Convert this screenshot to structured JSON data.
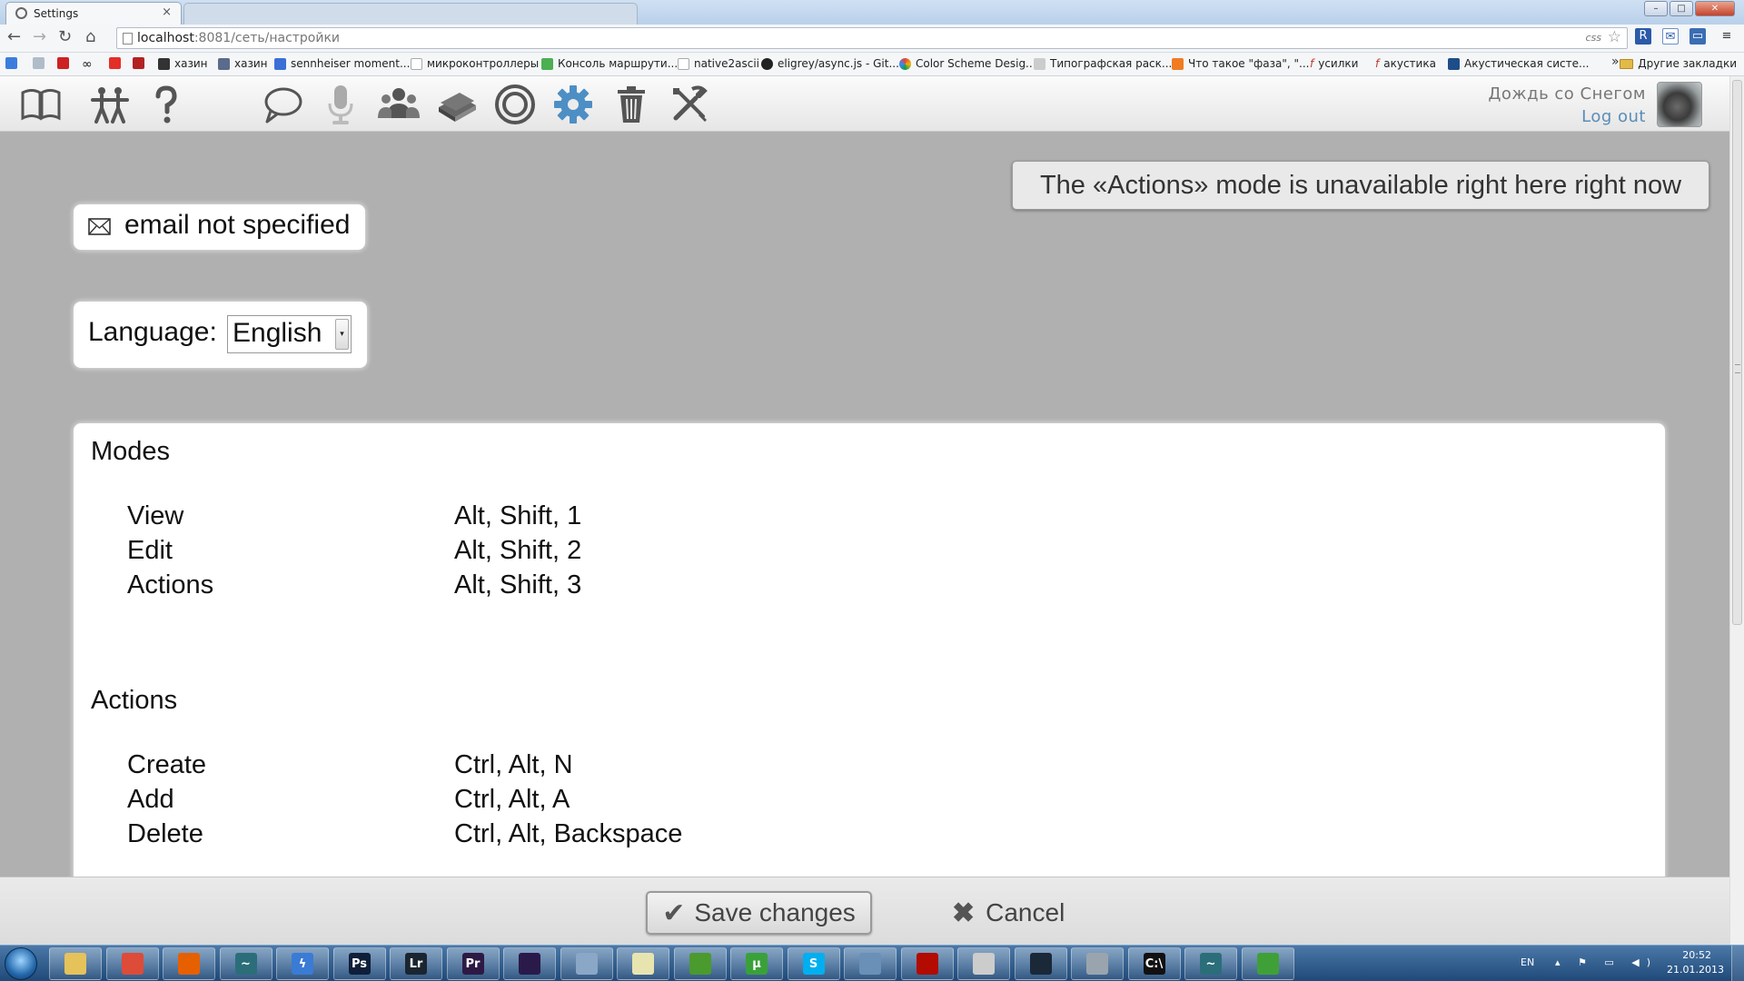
{
  "browser": {
    "active_tab_title": "Settings",
    "tab_close_glyph": "×",
    "url_host": "localhost",
    "url_path": ":8081/сеть/настройки",
    "css_badge": "css",
    "bookmarks": [
      {
        "label": "хазин",
        "color": "#333333"
      },
      {
        "label": "хазин",
        "color": "#5b6b8a"
      },
      {
        "label": "sennheiser moment...",
        "color": "#3b6fd6"
      },
      {
        "label": "микроконтроллеры",
        "color": "#bbbbbb"
      },
      {
        "label": "Консоль маршрути...",
        "color": "#4caf50"
      },
      {
        "label": "native2ascii",
        "color": "#bbbbbb"
      },
      {
        "label": "eligrey/async.js - Git...",
        "color": "#222222"
      },
      {
        "label": "Color Scheme Desig...",
        "color": "#e0463a"
      },
      {
        "label": "Типографская раск...",
        "color": "#bbbbbb"
      },
      {
        "label": "Что такое \"фаза\", \"...",
        "color": "#f07b22"
      },
      {
        "label": "усилки",
        "color": "#c0392b"
      },
      {
        "label": "акустика",
        "color": "#c0392b"
      },
      {
        "label": "Акустическая систе...",
        "color": "#1d4e89"
      }
    ],
    "bookmarks_more": "»",
    "other_bookmarks": "Другие закладки"
  },
  "toolbar": {
    "icons": [
      "book-icon",
      "people-icon",
      "help-icon",
      "comment-icon",
      "microphone-icon",
      "group-icon",
      "library-icon",
      "target-icon",
      "settings-gear-icon",
      "trash-icon",
      "tools-icon"
    ],
    "user_name": "Дождь со Снегом",
    "logout": "Log out"
  },
  "notice": "The «Actions» mode is unavailable right here right now",
  "email": {
    "text": "email not specified"
  },
  "language": {
    "label": "Language:",
    "selected": "English"
  },
  "hotkeys": {
    "sections": [
      {
        "title": "Modes",
        "rows": [
          {
            "name": "View",
            "keys": "Alt, Shift, 1"
          },
          {
            "name": "Edit",
            "keys": "Alt, Shift, 2"
          },
          {
            "name": "Actions",
            "keys": "Alt, Shift, 3"
          }
        ]
      },
      {
        "title": "Actions",
        "rows": [
          {
            "name": "Create",
            "keys": "Ctrl, Alt, N"
          },
          {
            "name": "Add",
            "keys": "Ctrl, Alt, A"
          },
          {
            "name": "Delete",
            "keys": "Ctrl, Alt, Backspace"
          }
        ]
      }
    ]
  },
  "bottom": {
    "save": "Save changes",
    "cancel": "Cancel"
  },
  "taskbar": {
    "apps": [
      {
        "name": "explorer-icon",
        "glyph": "",
        "color": "#e6c25a"
      },
      {
        "name": "chrome-icon",
        "glyph": "",
        "color": "#dd4b39"
      },
      {
        "name": "firefox-icon",
        "glyph": "",
        "color": "#e66000"
      },
      {
        "name": "dreamweaver-icon",
        "glyph": "~",
        "color": "#2b6e7a"
      },
      {
        "name": "download-manager-icon",
        "glyph": "ϟ",
        "color": "#3a7bd5"
      },
      {
        "name": "photoshop-icon",
        "glyph": "Ps",
        "color": "#0f1f3a"
      },
      {
        "name": "lightroom-icon",
        "glyph": "Lr",
        "color": "#1b2530"
      },
      {
        "name": "premiere-icon",
        "glyph": "Pr",
        "color": "#2d1a44"
      },
      {
        "name": "media-encoder-icon",
        "glyph": "",
        "color": "#2a1a4a"
      },
      {
        "name": "music-player-icon",
        "glyph": "",
        "color": "#8aa7c7"
      },
      {
        "name": "notepad-icon",
        "glyph": "",
        "color": "#e8e4b0"
      },
      {
        "name": "paint-icon",
        "glyph": "",
        "color": "#4b9a2e"
      },
      {
        "name": "utorrent-icon",
        "glyph": "µ",
        "color": "#3aa13a"
      },
      {
        "name": "skype-icon",
        "glyph": "S",
        "color": "#00aff0"
      },
      {
        "name": "remote-desktop-icon",
        "glyph": "",
        "color": "#6a90b8"
      },
      {
        "name": "acrobat-icon",
        "glyph": "",
        "color": "#b30b00"
      },
      {
        "name": "alien-icon",
        "glyph": "",
        "color": "#cccccc"
      },
      {
        "name": "steam-icon",
        "glyph": "",
        "color": "#1b2838"
      },
      {
        "name": "disc-icon",
        "glyph": "",
        "color": "#9aa4ae"
      },
      {
        "name": "terminal-icon",
        "glyph": "C:\\",
        "color": "#111111"
      },
      {
        "name": "dreamweaver2-icon",
        "glyph": "~",
        "color": "#2b6e7a"
      },
      {
        "name": "mongodb-icon",
        "glyph": "",
        "color": "#3fa037"
      }
    ],
    "lang": "EN",
    "time": "20:52",
    "date": "21.01.2013"
  }
}
